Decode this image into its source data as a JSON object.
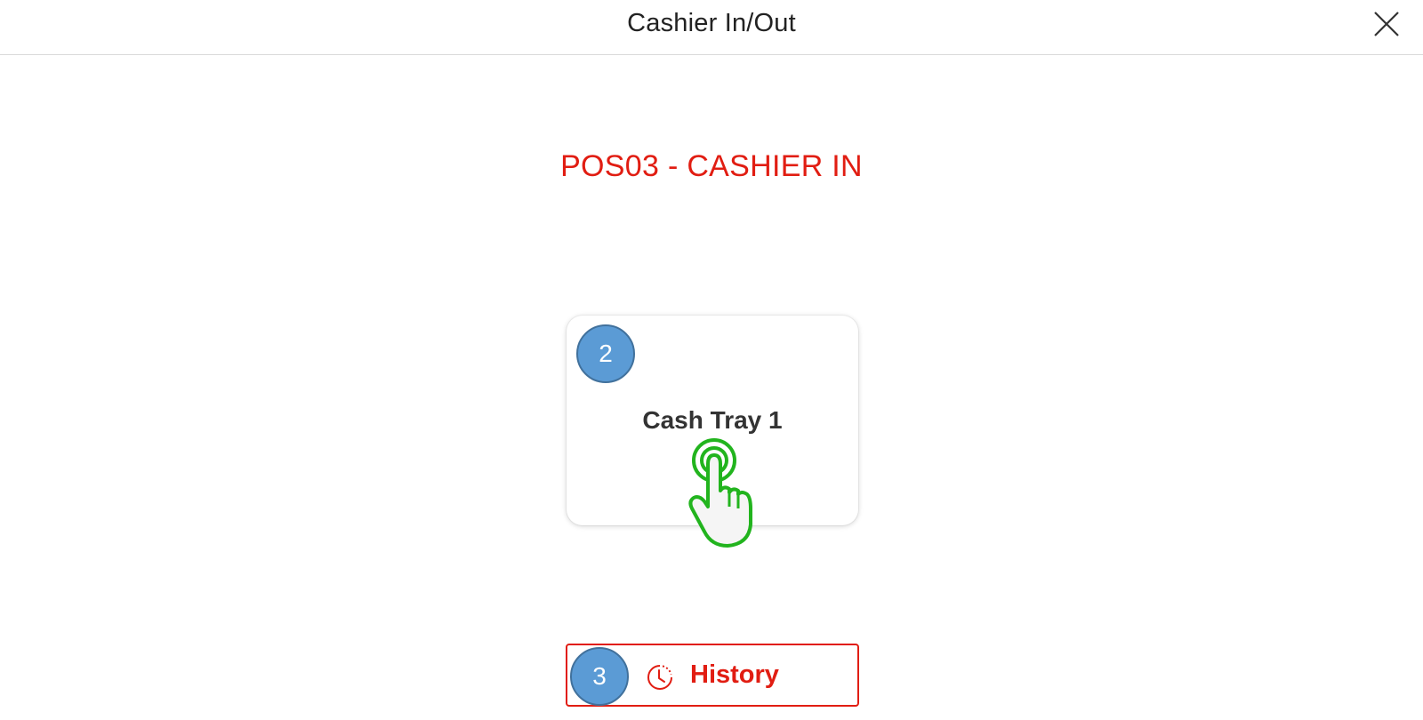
{
  "header": {
    "title": "Cashier In/Out",
    "close_icon": "close-icon"
  },
  "main": {
    "station_title": "POS03 - CASHIER IN",
    "tray": {
      "label": "Cash Tray 1",
      "step_number": "2"
    },
    "history": {
      "label": "History",
      "icon": "clock-history-icon",
      "step_number": "3"
    }
  },
  "colors": {
    "accent": "#e11d12",
    "step_badge": "#5b9bd5",
    "tap_indicator": "#22b41e"
  }
}
